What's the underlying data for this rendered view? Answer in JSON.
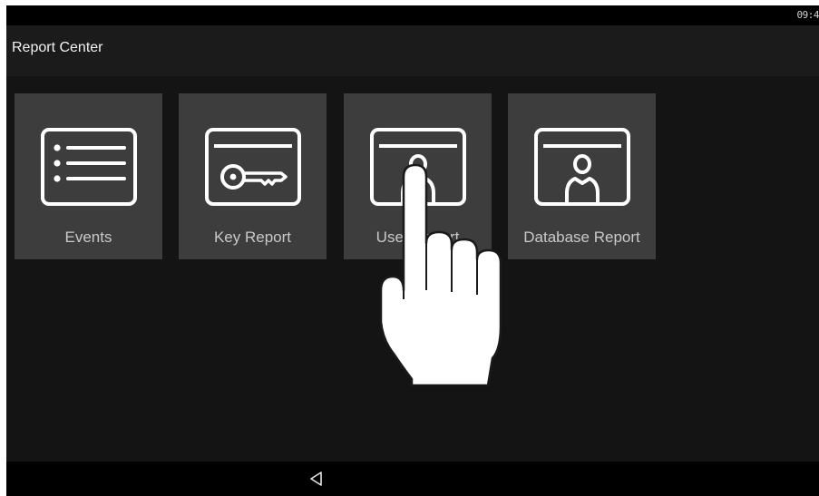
{
  "status_bar": {
    "time": "09:4"
  },
  "app_bar": {
    "title": "Report Center"
  },
  "tiles": [
    {
      "label": "Events",
      "icon": "list-icon"
    },
    {
      "label": "Key Report",
      "icon": "key-card-icon"
    },
    {
      "label": "User Report",
      "icon": "user-card-icon"
    },
    {
      "label": "Database Report",
      "icon": "user-card-icon"
    }
  ],
  "nav_bar": {
    "back_icon": "back-triangle-icon"
  },
  "overlay": {
    "icon": "pointing-hand-icon"
  },
  "colors": {
    "background": "#141414",
    "tile": "#3d3d3d",
    "icon_stroke": "#ffffff",
    "label": "#c9c9c9"
  }
}
